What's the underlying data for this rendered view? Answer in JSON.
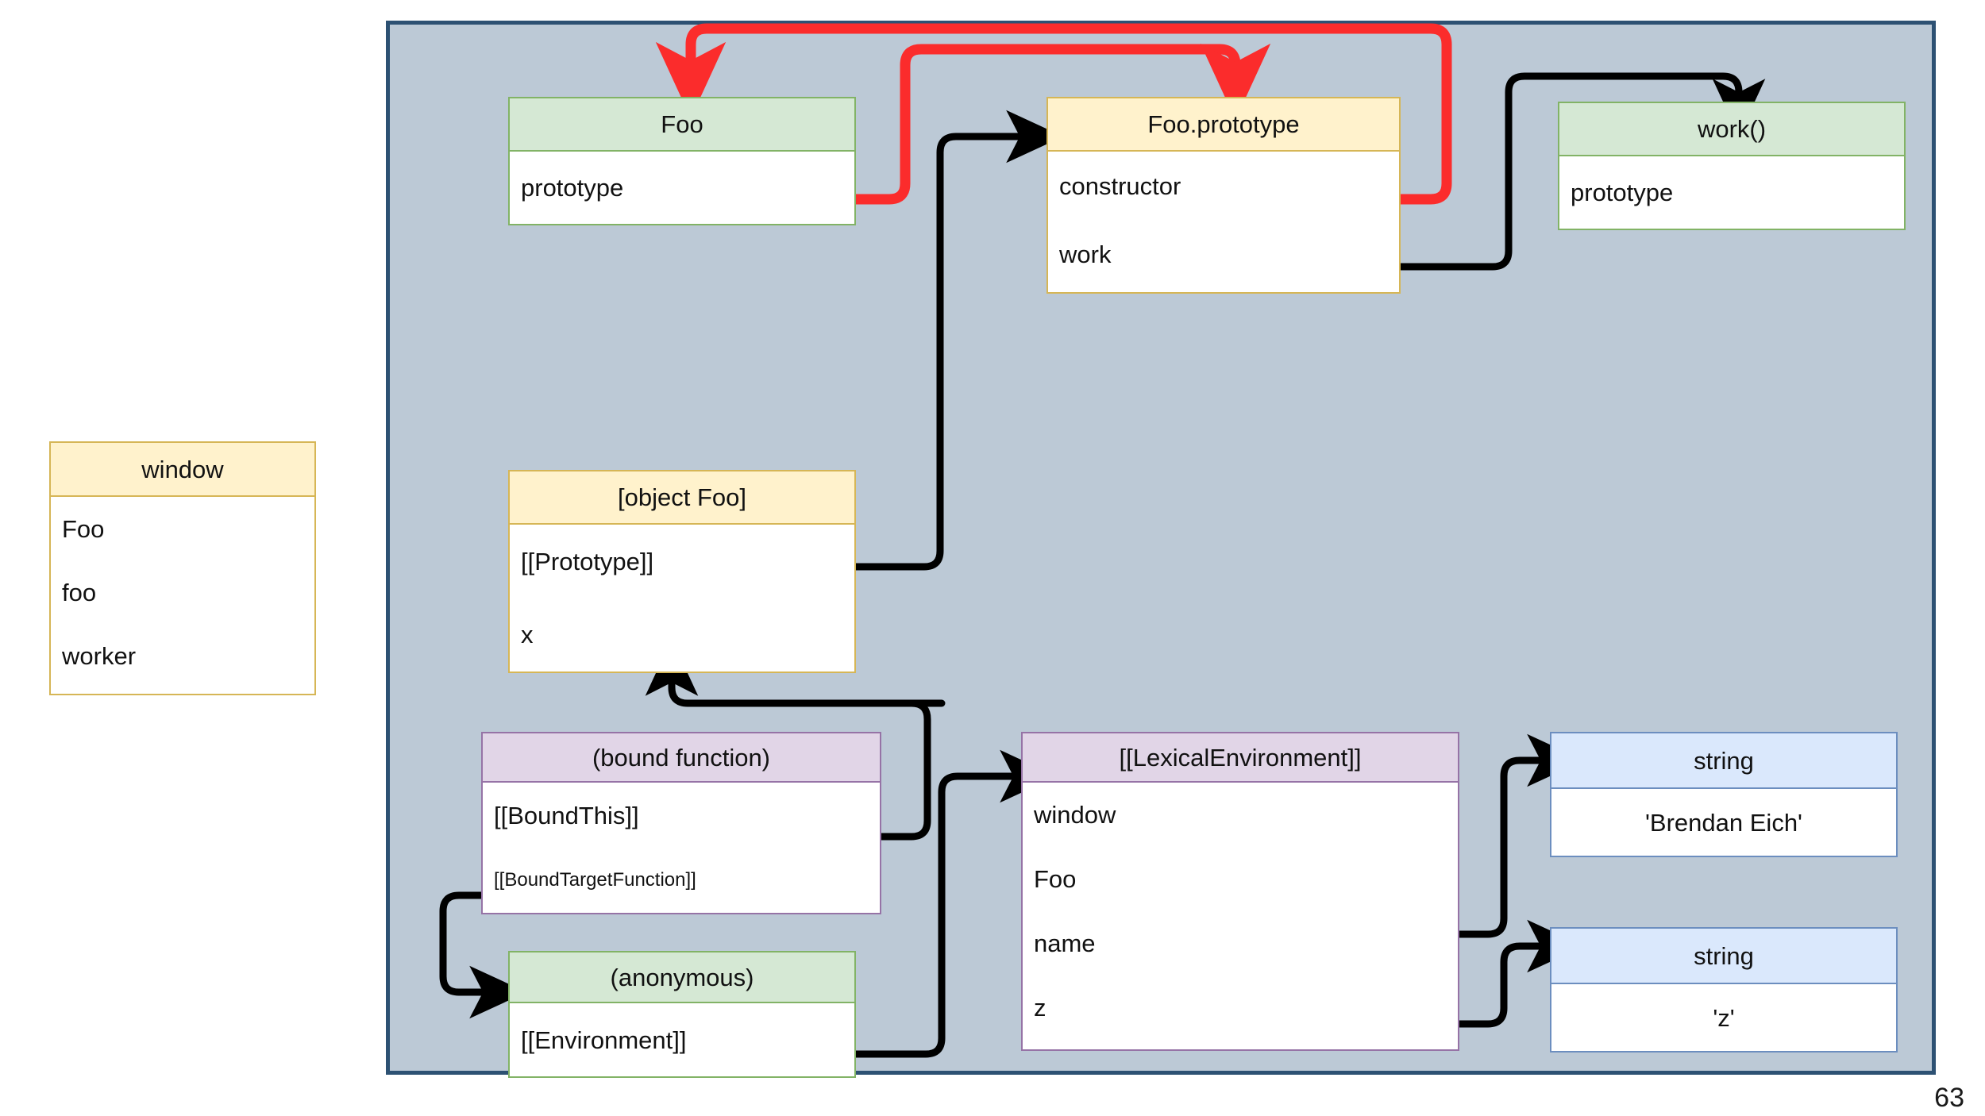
{
  "slide": {
    "page_number": "63",
    "background_color": "#bcc9d6",
    "border_color": "#2d5173"
  },
  "colors": {
    "green_fill": "#d5e8d4",
    "green_stroke": "#82b366",
    "yellow_fill": "#fff2cc",
    "yellow_stroke": "#d6b656",
    "purple_fill": "#e1d5e7",
    "purple_stroke": "#9673a6",
    "blue_fill": "#dae8fc",
    "blue_stroke": "#6c8ebf",
    "arrow_black": "#000000",
    "arrow_red": "#fb2c2c"
  },
  "nodes": {
    "window": {
      "title": "window",
      "rows": [
        "Foo",
        "foo",
        "worker"
      ]
    },
    "foo": {
      "title": "Foo",
      "rows": [
        "prototype"
      ]
    },
    "foo_prototype": {
      "title": "Foo.prototype",
      "rows": [
        "constructor",
        "work"
      ]
    },
    "work": {
      "title": "work()",
      "rows": [
        "prototype"
      ]
    },
    "object_foo": {
      "title": "[object Foo]",
      "rows": [
        "[[Prototype]]",
        "x"
      ]
    },
    "bound_function": {
      "title": "(bound function)",
      "rows": [
        "[[BoundThis]]",
        "[[BoundTargetFunction]]"
      ]
    },
    "anonymous": {
      "title": "(anonymous)",
      "rows": [
        "[[Environment]]"
      ]
    },
    "lexical_environment": {
      "title": "[[LexicalEnvironment]]",
      "rows": [
        "window",
        "Foo",
        "name",
        "z"
      ]
    },
    "string_brendan": {
      "title": "string",
      "rows": [
        "'Brendan Eich'"
      ]
    },
    "string_z": {
      "title": "string",
      "rows": [
        "'z'"
      ]
    }
  }
}
